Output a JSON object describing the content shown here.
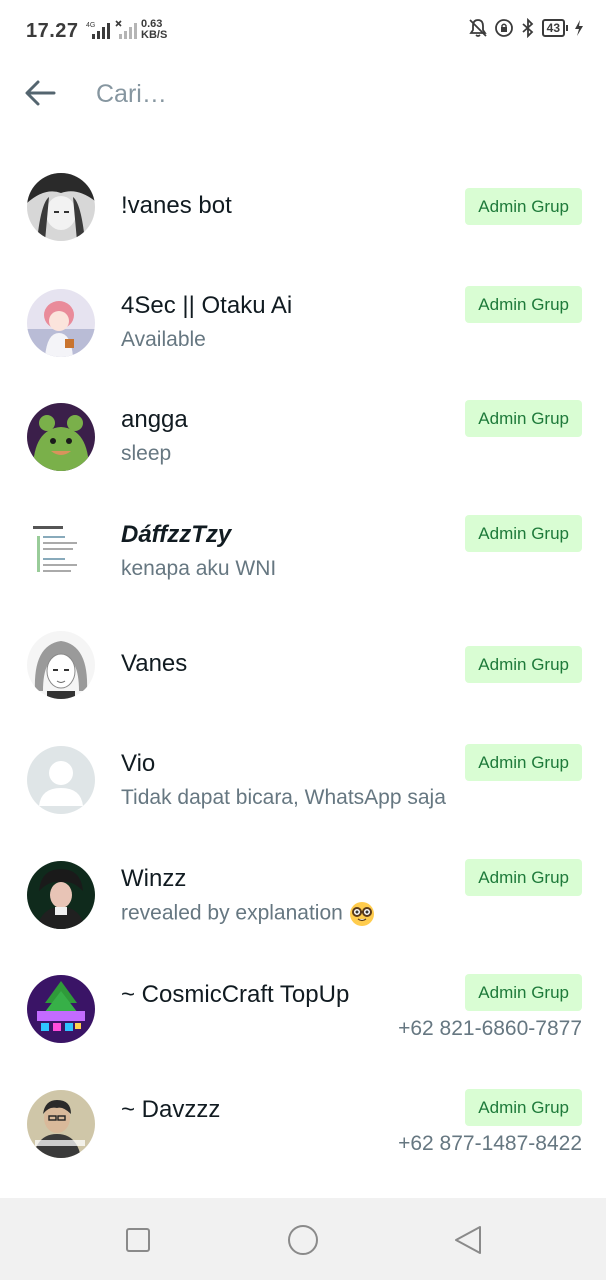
{
  "status_bar": {
    "time": "17.27",
    "network_type": "4G",
    "net_speed_value": "0.63",
    "net_speed_unit": "KB/S",
    "battery": "43",
    "icons": [
      "mute-icon",
      "lock-rotation-icon",
      "bluetooth-icon",
      "battery-icon",
      "charging-icon"
    ]
  },
  "search": {
    "placeholder": "Cari…",
    "value": ""
  },
  "members": [
    {
      "name": "!vanes bot",
      "about": "",
      "phone": "",
      "badge": "Admin Grup"
    },
    {
      "name": "4Sec || Otaku Ai",
      "about": "Available",
      "phone": "",
      "badge": "Admin Grup"
    },
    {
      "name": "angga",
      "about": "sleep",
      "phone": "",
      "badge": "Admin Grup"
    },
    {
      "name": "DáffzzTzy",
      "about": "kenapa aku WNI",
      "phone": "",
      "badge": "Admin Grup"
    },
    {
      "name": "Vanes",
      "about": "",
      "phone": "",
      "badge": "Admin Grup"
    },
    {
      "name": "Vio",
      "about": "Tidak dapat bicara, WhatsApp saja",
      "phone": "",
      "badge": "Admin Grup"
    },
    {
      "name": "Winzz",
      "about": "revealed by explanation",
      "phone": "",
      "badge": "Admin Grup"
    },
    {
      "name": "~ CosmicCraft TopUp",
      "about": "",
      "phone": "+62 821-6860-7877",
      "badge": "Admin Grup"
    },
    {
      "name": "~ Davzzz",
      "about": "",
      "phone": "+62 877-1487-8422",
      "badge": "Admin Grup"
    }
  ],
  "colors": {
    "badge_bg": "#d9fdd3",
    "badge_text": "#1e7a3a",
    "secondary_text": "#667781",
    "nav_bg": "#f1f1f1"
  },
  "nav": [
    "recents-square-icon",
    "home-circle-icon",
    "back-triangle-icon"
  ]
}
